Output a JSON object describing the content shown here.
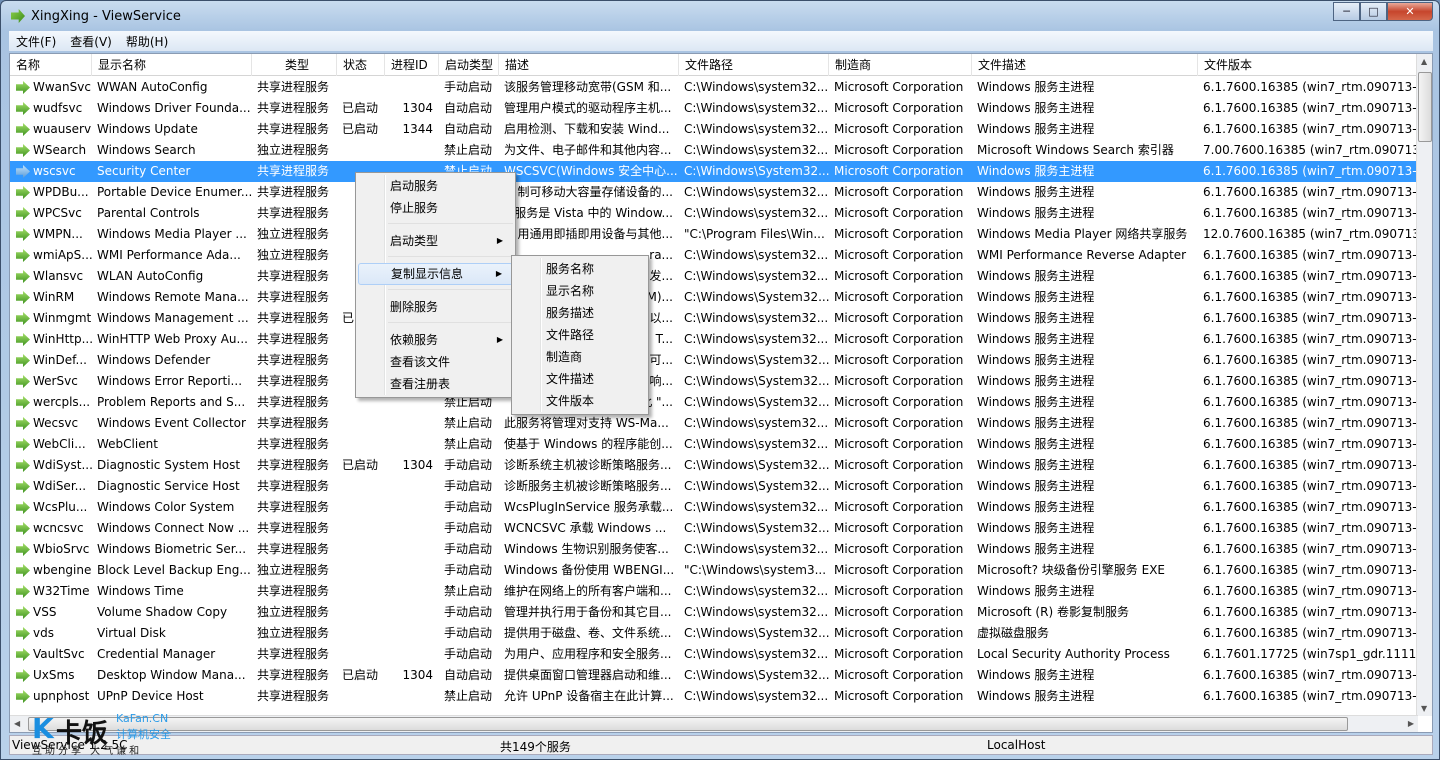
{
  "window": {
    "title": "XingXing - ViewService",
    "minimize": "─",
    "maximize": "□",
    "close": "✕"
  },
  "menu": [
    "文件(F)",
    "查看(V)",
    "帮助(H)"
  ],
  "columns": [
    "名称",
    "显示名称",
    "类型",
    "状态",
    "进程ID",
    "启动类型",
    "描述",
    "文件路径",
    "制造商",
    "文件描述",
    "文件版本"
  ],
  "rows": [
    [
      "WwanSvc",
      "WWAN AutoConfig",
      "共享进程服务",
      "",
      "",
      "手动启动",
      "该服务管理移动宽带(GSM 和...",
      "C:\\Windows\\system32...",
      "Microsoft Corporation",
      "Windows 服务主进程",
      "6.1.7600.16385 (win7_rtm.090713-125"
    ],
    [
      "wudfsvc",
      "Windows Driver Founda...",
      "共享进程服务",
      "已启动",
      "1304",
      "自动启动",
      "管理用户模式的驱动程序主机...",
      "C:\\Windows\\system32...",
      "Microsoft Corporation",
      "Windows 服务主进程",
      "6.1.7600.16385 (win7_rtm.090713-125"
    ],
    [
      "wuauserv",
      "Windows Update",
      "共享进程服务",
      "已启动",
      "1344",
      "自动启动",
      "启用检测、下载和安装 Wind...",
      "C:\\Windows\\system32...",
      "Microsoft Corporation",
      "Windows 服务主进程",
      "6.1.7600.16385 (win7_rtm.090713-125"
    ],
    [
      "WSearch",
      "Windows Search",
      "独立进程服务",
      "",
      "",
      "禁止启动",
      "为文件、电子邮件和其他内容...",
      "C:\\Windows\\system32...",
      "Microsoft Corporation",
      "Microsoft Windows Search 索引器",
      "7.00.7600.16385 (win7_rtm.090713-12"
    ],
    [
      "wscsvc",
      "Security Center",
      "共享进程服务",
      "",
      "",
      "禁止启动",
      "WSCSVC(Windows 安全中心...",
      "C:\\Windows\\System32...",
      "Microsoft Corporation",
      "Windows 服务主进程",
      "6.1.7600.16385 (win7_rtm.090713-125"
    ],
    [
      "WPDBu...",
      "Portable Device Enumer...",
      "共享进程服务",
      "",
      "",
      "",
      "制可移动大容量存储设备的...",
      "C:\\Windows\\system32...",
      "Microsoft Corporation",
      "Windows 服务主进程",
      "6.1.7600.16385 (win7_rtm.090713-125"
    ],
    [
      "WPCSvc",
      "Parental Controls",
      "共享进程服务",
      "",
      "",
      "",
      "服务是 Vista 中的 Window...",
      "C:\\Windows\\system32...",
      "Microsoft Corporation",
      "Windows 服务主进程",
      "6.1.7600.16385 (win7_rtm.090713-125"
    ],
    [
      "WMPN...",
      "Windows Media Player ...",
      "独立进程服务",
      "",
      "",
      "",
      "用通用即插即用设备与其他...",
      "\"C:\\Program Files\\Win...",
      "Microsoft Corporation",
      "Windows Media Player 网络共享服务",
      "12.0.7600.16385 (win7_rtm.090713-12"
    ],
    [
      "wmiApS...",
      "WMI Performance Ada...",
      "独立进程服务",
      "",
      "",
      "",
      "ra...",
      "C:\\Windows\\system32...",
      "Microsoft Corporation",
      "WMI Performance Reverse Adapter",
      "6.1.7600.16385 (win7_rtm.090713-125"
    ],
    [
      "Wlansvc",
      "WLAN AutoConfig",
      "共享进程服务",
      "",
      "",
      "",
      "发...",
      "C:\\Windows\\system32...",
      "Microsoft Corporation",
      "Windows 服务主进程",
      "6.1.7600.16385 (win7_rtm.090713-125"
    ],
    [
      "WinRM",
      "Windows Remote Mana...",
      "共享进程服务",
      "",
      "",
      "",
      "M)...",
      "C:\\Windows\\System32...",
      "Microsoft Corporation",
      "Windows 服务主进程",
      "6.1.7600.16385 (win7_rtm.090713-125"
    ],
    [
      "Winmgmt",
      "Windows Management ...",
      "共享进程服务",
      "已",
      "",
      "",
      "以...",
      "C:\\Windows\\system32...",
      "Microsoft Corporation",
      "Windows 服务主进程",
      "6.1.7600.16385 (win7_rtm.090713-125"
    ],
    [
      "WinHttp...",
      "WinHTTP Web Proxy Au...",
      "共享进程服务",
      "",
      "",
      "",
      "T...",
      "C:\\Windows\\system32...",
      "Microsoft Corporation",
      "Windows 服务主进程",
      "6.1.7600.16385 (win7_rtm.090713-125"
    ],
    [
      "WinDef...",
      "Windows Defender",
      "共享进程服务",
      "",
      "",
      "",
      "可...",
      "C:\\Windows\\System32...",
      "Microsoft Corporation",
      "Windows 服务主进程",
      "6.1.7600.16385 (win7_rtm.090713-125"
    ],
    [
      "WerSvc",
      "Windows Error Reporti...",
      "共享进程服务",
      "",
      "",
      "",
      "响...",
      "C:\\Windows\\System32...",
      "Microsoft Corporation",
      "Windows 服务主进程",
      "6.1.7600.16385 (win7_rtm.090713-125"
    ],
    [
      "wercpls...",
      "Problem Reports and S...",
      "共享进程服务",
      "",
      "",
      "禁止启动",
      "此 \"...",
      "C:\\Windows\\System32...",
      "Microsoft Corporation",
      "Windows 服务主进程",
      "6.1.7600.16385 (win7_rtm.090713-125"
    ],
    [
      "Wecsvc",
      "Windows Event Collector",
      "共享进程服务",
      "",
      "",
      "禁止启动",
      "此服务将管理对支持 WS-Ma...",
      "C:\\Windows\\system32...",
      "Microsoft Corporation",
      "Windows 服务主进程",
      "6.1.7600.16385 (win7_rtm.090713-125"
    ],
    [
      "WebCli...",
      "WebClient",
      "共享进程服务",
      "",
      "",
      "禁止启动",
      "使基于 Windows 的程序能创...",
      "C:\\Windows\\system32...",
      "Microsoft Corporation",
      "Windows 服务主进程",
      "6.1.7600.16385 (win7_rtm.090713-125"
    ],
    [
      "WdiSyst...",
      "Diagnostic System Host",
      "共享进程服务",
      "已启动",
      "1304",
      "手动启动",
      "诊断系统主机被诊断策略服务...",
      "C:\\Windows\\System32...",
      "Microsoft Corporation",
      "Windows 服务主进程",
      "6.1.7600.16385 (win7_rtm.090713-125"
    ],
    [
      "WdiSer...",
      "Diagnostic Service Host",
      "共享进程服务",
      "",
      "",
      "手动启动",
      "诊断服务主机被诊断策略服务...",
      "C:\\Windows\\System32...",
      "Microsoft Corporation",
      "Windows 服务主进程",
      "6.1.7600.16385 (win7_rtm.090713-125"
    ],
    [
      "WcsPlu...",
      "Windows Color System",
      "共享进程服务",
      "",
      "",
      "手动启动",
      "WcsPlugInService 服务承载...",
      "C:\\Windows\\system32...",
      "Microsoft Corporation",
      "Windows 服务主进程",
      "6.1.7600.16385 (win7_rtm.090713-125"
    ],
    [
      "wcncsvc",
      "Windows Connect Now ...",
      "共享进程服务",
      "",
      "",
      "手动启动",
      "WCNCSVC 承载 Windows ...",
      "C:\\Windows\\System32...",
      "Microsoft Corporation",
      "Windows 服务主进程",
      "6.1.7600.16385 (win7_rtm.090713-125"
    ],
    [
      "WbioSrvc",
      "Windows Biometric Ser...",
      "共享进程服务",
      "",
      "",
      "手动启动",
      "Windows 生物识别服务使客...",
      "C:\\Windows\\system32...",
      "Microsoft Corporation",
      "Windows 服务主进程",
      "6.1.7600.16385 (win7_rtm.090713-125"
    ],
    [
      "wbengine",
      "Block Level Backup Eng...",
      "独立进程服务",
      "",
      "",
      "手动启动",
      "Windows 备份使用 WBENGI...",
      "\"C:\\Windows\\system3...",
      "Microsoft Corporation",
      "Microsoft? 块级备份引擎服务 EXE",
      "6.1.7600.16385 (win7_rtm.090713-125"
    ],
    [
      "W32Time",
      "Windows Time",
      "共享进程服务",
      "",
      "",
      "禁止启动",
      "维护在网络上的所有客户端和...",
      "C:\\Windows\\system32...",
      "Microsoft Corporation",
      "Windows 服务主进程",
      "6.1.7600.16385 (win7_rtm.090713-125"
    ],
    [
      "VSS",
      "Volume Shadow Copy",
      "独立进程服务",
      "",
      "",
      "手动启动",
      "管理并执行用于备份和其它目...",
      "C:\\Windows\\system32...",
      "Microsoft Corporation",
      "Microsoft (R) 卷影复制服务",
      "6.1.7600.16385 (win7_rtm.090713-125"
    ],
    [
      "vds",
      "Virtual Disk",
      "独立进程服务",
      "",
      "",
      "手动启动",
      "提供用于磁盘、卷、文件系统...",
      "C:\\Windows\\System32...",
      "Microsoft Corporation",
      "虚拟磁盘服务",
      "6.1.7600.16385 (win7_rtm.090713-125"
    ],
    [
      "VaultSvc",
      "Credential Manager",
      "共享进程服务",
      "",
      "",
      "手动启动",
      "为用户、应用程序和安全服务...",
      "C:\\Windows\\system32...",
      "Microsoft Corporation",
      "Local Security Authority Process",
      "6.1.7601.17725 (win7sp1_gdr.111116"
    ],
    [
      "UxSms",
      "Desktop Window Mana...",
      "共享进程服务",
      "已启动",
      "1304",
      "自动启动",
      "提供桌面窗口管理器启动和维...",
      "C:\\Windows\\System32...",
      "Microsoft Corporation",
      "Windows 服务主进程",
      "6.1.7600.16385 (win7_rtm.090713-125"
    ],
    [
      "upnphost",
      "UPnP Device Host",
      "共享进程服务",
      "",
      "",
      "禁止启动",
      "允许 UPnP 设备宿主在此计算...",
      "C:\\Windows\\system32...",
      "Microsoft Corporation",
      "Windows 服务主进程",
      "6.1.7600.16385 (win7_rtm.090713-125"
    ]
  ],
  "selected_row": "wscsvc",
  "context_menu": {
    "items": [
      {
        "label": "启动服务"
      },
      {
        "label": "停止服务"
      },
      {
        "sep": true
      },
      {
        "label": "启动类型",
        "submenu": true
      },
      {
        "sep": true
      },
      {
        "label": "复制显示信息",
        "submenu": true,
        "hot": true
      },
      {
        "sep": true
      },
      {
        "label": "删除服务"
      },
      {
        "sep": true
      },
      {
        "label": "依赖服务",
        "submenu": true
      },
      {
        "label": "查看该文件"
      },
      {
        "label": "查看注册表"
      }
    ],
    "submenu": [
      "服务名称",
      "显示名称",
      "服务描述",
      "文件路径",
      "制造商",
      "文件描述",
      "文件版本"
    ]
  },
  "status": {
    "version": "ViewService 1.2.5C",
    "count": "共149个服务",
    "host": "LocalHost"
  },
  "watermark": {
    "logo": "K卡饭",
    "site": "KaFan.CN",
    "tagline": "计算机安全",
    "slogan": "互助分享 大气谦和"
  },
  "colors": {
    "selection": "#3399ff",
    "service_icon": "#5cb531"
  }
}
